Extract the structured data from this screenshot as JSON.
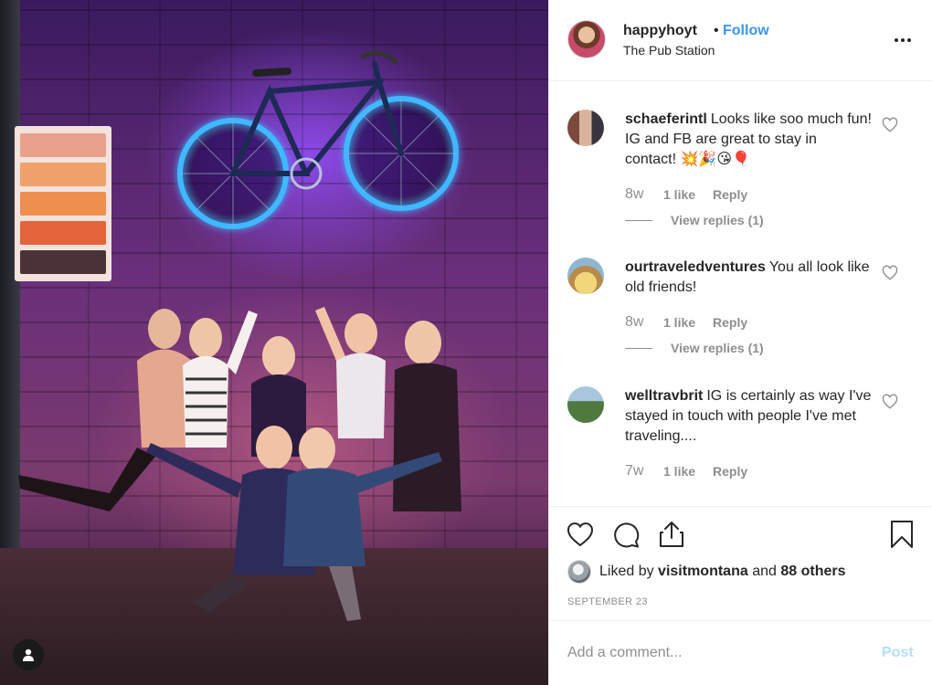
{
  "header": {
    "username": "happyhoyt",
    "separator": "•",
    "follow_label": "Follow",
    "location": "The Pub Station",
    "more_icon": "more-options-icon"
  },
  "comments": [
    {
      "username": "schaeferintl",
      "text": "Looks like soo much fun! IG and FB are great to stay in contact! 💥🎉😘🎈",
      "time": "8w",
      "likes": "1 like",
      "reply_label": "Reply",
      "view_replies": "View replies (1)"
    },
    {
      "username": "ourtraveledventures",
      "text": "You all look like old friends!",
      "time": "8w",
      "likes": "1 like",
      "reply_label": "Reply",
      "view_replies": "View replies (1)"
    },
    {
      "username": "welltravbrit",
      "text": "IG is certainly as way I've stayed in touch with people I've met traveling....",
      "time": "7w",
      "likes": "1 like",
      "reply_label": "Reply"
    }
  ],
  "actions": {
    "icons": [
      "heart-icon",
      "comment-icon",
      "share-icon",
      "bookmark-icon"
    ],
    "liked_by_prefix": "Liked by",
    "liked_by_user": "visitmontana",
    "liked_by_and": "and",
    "liked_by_others": "88 others",
    "date": "SEPTEMBER 23"
  },
  "comment_box": {
    "placeholder": "Add a comment...",
    "post_label": "Post"
  },
  "colors": {
    "link_blue": "#3897f0",
    "post_disabled": "#b2dffc",
    "muted": "#8e8e8e",
    "text": "#262626",
    "neon": "#3fb8ff"
  }
}
